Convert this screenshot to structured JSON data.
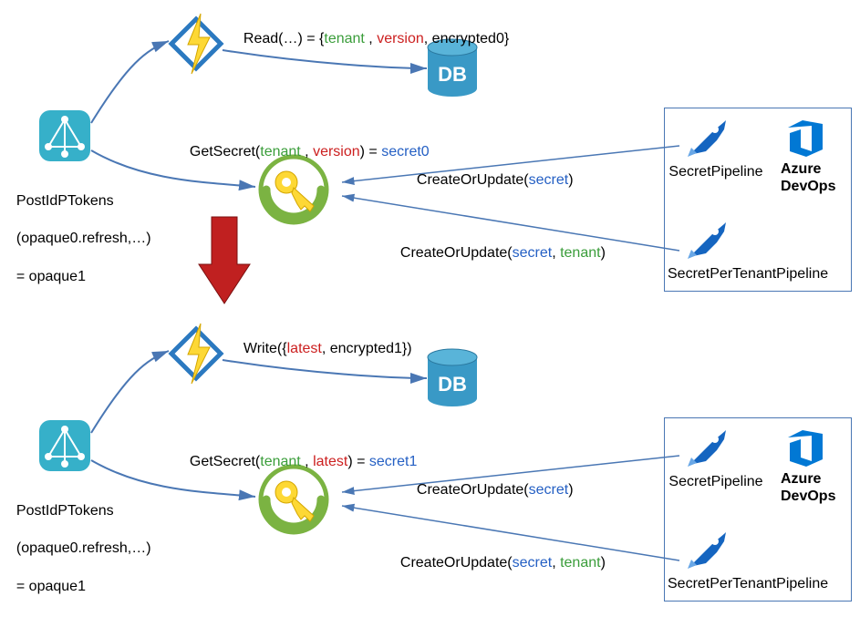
{
  "top": {
    "readLabel": "Read(…) = {",
    "readTenant": "tenant",
    "readComma1": " , ",
    "readVersion": "version",
    "readComma2": ", ",
    "readEnc": "encrypted0",
    "readClose": "}",
    "getSecretPrefix": "GetSecret(",
    "getSecretTenant": "tenant",
    "getSecretComma": " , ",
    "getSecretVersion": "version",
    "getSecretMid": ") = ",
    "getSecretResult": "secret0",
    "createUpdate1a": "CreateOrUpdate(",
    "createUpdate1b": "secret",
    "createUpdate1c": ")",
    "createUpdate2a": "CreateOrUpdate(",
    "createUpdate2b": "secret",
    "createUpdate2c": ", ",
    "createUpdate2d": "tenant",
    "createUpdate2e": ")"
  },
  "bottom": {
    "writeLabel": "Write({",
    "writeLatest": "latest",
    "writeComma": ", ",
    "writeEnc": "encrypted1",
    "writeClose": "})",
    "getSecretPrefix": "GetSecret(",
    "getSecretTenant": "tenant",
    "getSecretComma": " , ",
    "getSecretVersion": "latest",
    "getSecretMid": ") = ",
    "getSecretResult": "secret1",
    "createUpdate1a": "CreateOrUpdate(",
    "createUpdate1b": "secret",
    "createUpdate1c": ")",
    "createUpdate2a": "CreateOrUpdate(",
    "createUpdate2b": "secret",
    "createUpdate2c": ", ",
    "createUpdate2d": "tenant",
    "createUpdate2e": ")"
  },
  "apim": {
    "line1": "PostIdPTokens",
    "line2": "(opaque0.refresh,…)",
    "line3": "= opaque1"
  },
  "pipelineLabels": {
    "secret": "SecretPipeline",
    "perTenant": "SecretPerTenantPipeline",
    "azure": "Azure\nDevOps"
  },
  "icons": {
    "function": "azure-functions-icon",
    "apim": "azure-api-management-icon",
    "db": "azure-sql-database-icon",
    "keyvault": "azure-key-vault-icon",
    "rocket": "azure-pipelines-rocket-icon",
    "devops": "azure-devops-icon",
    "arrow": "red-down-arrow-icon"
  }
}
